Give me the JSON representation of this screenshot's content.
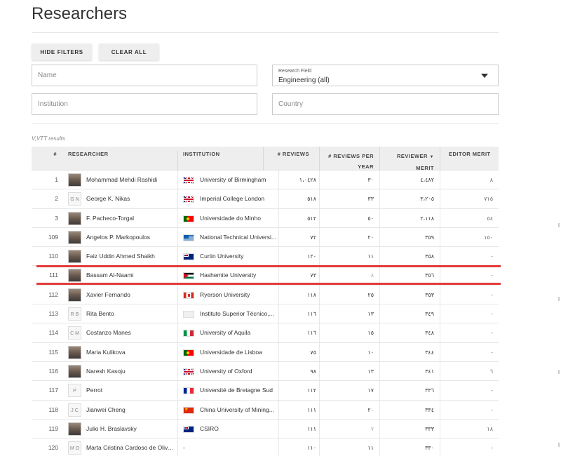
{
  "page": {
    "title": "Researchers"
  },
  "filters": {
    "hide_label": "HIDE FILTERS",
    "clear_label": "CLEAR ALL",
    "name_placeholder": "Name",
    "institution_placeholder": "Institution",
    "country_placeholder": "Country",
    "field_label": "Research Field",
    "field_value": "Engineering (all)"
  },
  "results": {
    "count_text": "V,VTT results"
  },
  "table": {
    "headers": {
      "num": "#",
      "researcher": "RESEARCHER",
      "institution": "INSTITUTION",
      "reviews": "# REVIEWS",
      "reviews_per_year_1": "# REVIEWS PER",
      "reviews_per_year_2": "YEAR",
      "merit_1": "REVIEWER",
      "merit_sort": "▼",
      "merit_2": "MERIT",
      "editor": "EDITOR MERIT"
    },
    "rows": [
      {
        "num": "1",
        "avatar": "",
        "name": "Mohammad Mehdi Rashidi",
        "flag": "uk",
        "institution": "University of Birmingham",
        "reviews": "١،٠٤٢٨",
        "rpy": "٣٠",
        "merit": "٤،٤٨٢",
        "editor": "٨"
      },
      {
        "num": "2",
        "avatar": "G N",
        "name": "George K. Nikas",
        "flag": "uk",
        "institution": "Imperial College London",
        "reviews": "٥١٨",
        "rpy": "٣٣",
        "merit": "٣،٢٠٥",
        "editor": "٧١٥"
      },
      {
        "num": "3",
        "avatar": "",
        "name": "F. Pacheco-Torgal",
        "flag": "pt",
        "institution": "Universidade do Minho",
        "reviews": "٥١٢",
        "rpy": "٥٠",
        "merit": "٢،١١٨",
        "editor": "٥٤"
      },
      {
        "num": "109",
        "avatar": "",
        "name": "Angelos P. Markopoulos",
        "flag": "gr",
        "institution": "National Technical Universi...",
        "reviews": "٧٢",
        "rpy": "٢٠",
        "merit": "٣٥٩",
        "editor": "١٥٠"
      },
      {
        "num": "110",
        "avatar": "",
        "name": "Faiz Uddin Ahmed Shaikh",
        "flag": "au",
        "institution": "Curtin University",
        "reviews": "١٢٠",
        "rpy": "١١",
        "merit": "٣٥٨",
        "editor": "-"
      },
      {
        "num": "111",
        "avatar": "",
        "name": "Bassam Al-Naami",
        "flag": "jo",
        "institution": "Hashemite University",
        "reviews": "٧٣",
        "rpy": "٨",
        "merit": "٣٥٦",
        "editor": "-"
      },
      {
        "num": "112",
        "avatar": "",
        "name": "Xavier Fernando",
        "flag": "ca",
        "institution": "Ryerson University",
        "reviews": "١١٨",
        "rpy": "٢٥",
        "merit": "٣٥٣",
        "editor": "-"
      },
      {
        "num": "113",
        "avatar": "R B",
        "name": "Rita Bento",
        "flag": "blank",
        "institution": "Instituto Superior Técnico,...",
        "reviews": "١١٦",
        "rpy": "١٣",
        "merit": "٣٤٩",
        "editor": "-"
      },
      {
        "num": "114",
        "avatar": "C M",
        "name": "Costanzo Manes",
        "flag": "it",
        "institution": "University of Aquila",
        "reviews": "١١٦",
        "rpy": "١٥",
        "merit": "٣٤٨",
        "editor": "-"
      },
      {
        "num": "115",
        "avatar": "",
        "name": "Maria Kulikova",
        "flag": "pt",
        "institution": "Universidade de Lisboa",
        "reviews": "٧٥",
        "rpy": "١٠",
        "merit": "٣٤٤",
        "editor": "-"
      },
      {
        "num": "116",
        "avatar": "",
        "name": "Naresh Kasoju",
        "flag": "uk",
        "institution": "University of Oxford",
        "reviews": "٩٨",
        "rpy": "١٣",
        "merit": "٣٤١",
        "editor": "٦"
      },
      {
        "num": "117",
        "avatar": "P",
        "name": "Perrot",
        "flag": "fr",
        "institution": "Université de Bretagne Sud",
        "reviews": "١١٢",
        "rpy": "١٧",
        "merit": "٣٣٦",
        "editor": "-"
      },
      {
        "num": "118",
        "avatar": "J C",
        "name": "Jianwei Cheng",
        "flag": "cn",
        "institution": "China University of Mining...",
        "reviews": "١١١",
        "rpy": "٢٠",
        "merit": "٣٣٤",
        "editor": "-"
      },
      {
        "num": "119",
        "avatar": "",
        "name": "Julio H. Braslavsky",
        "flag": "au",
        "institution": "CSIRO",
        "reviews": "١١١",
        "rpy": "٧",
        "merit": "٣٣٣",
        "editor": "١٨"
      },
      {
        "num": "120",
        "avatar": "M O",
        "name": "Marta Cristina Cardoso de Oliveira",
        "flag": "",
        "institution": "-",
        "reviews": "١١٠",
        "rpy": "١١",
        "merit": "٣٣٠",
        "editor": "-"
      }
    ]
  }
}
